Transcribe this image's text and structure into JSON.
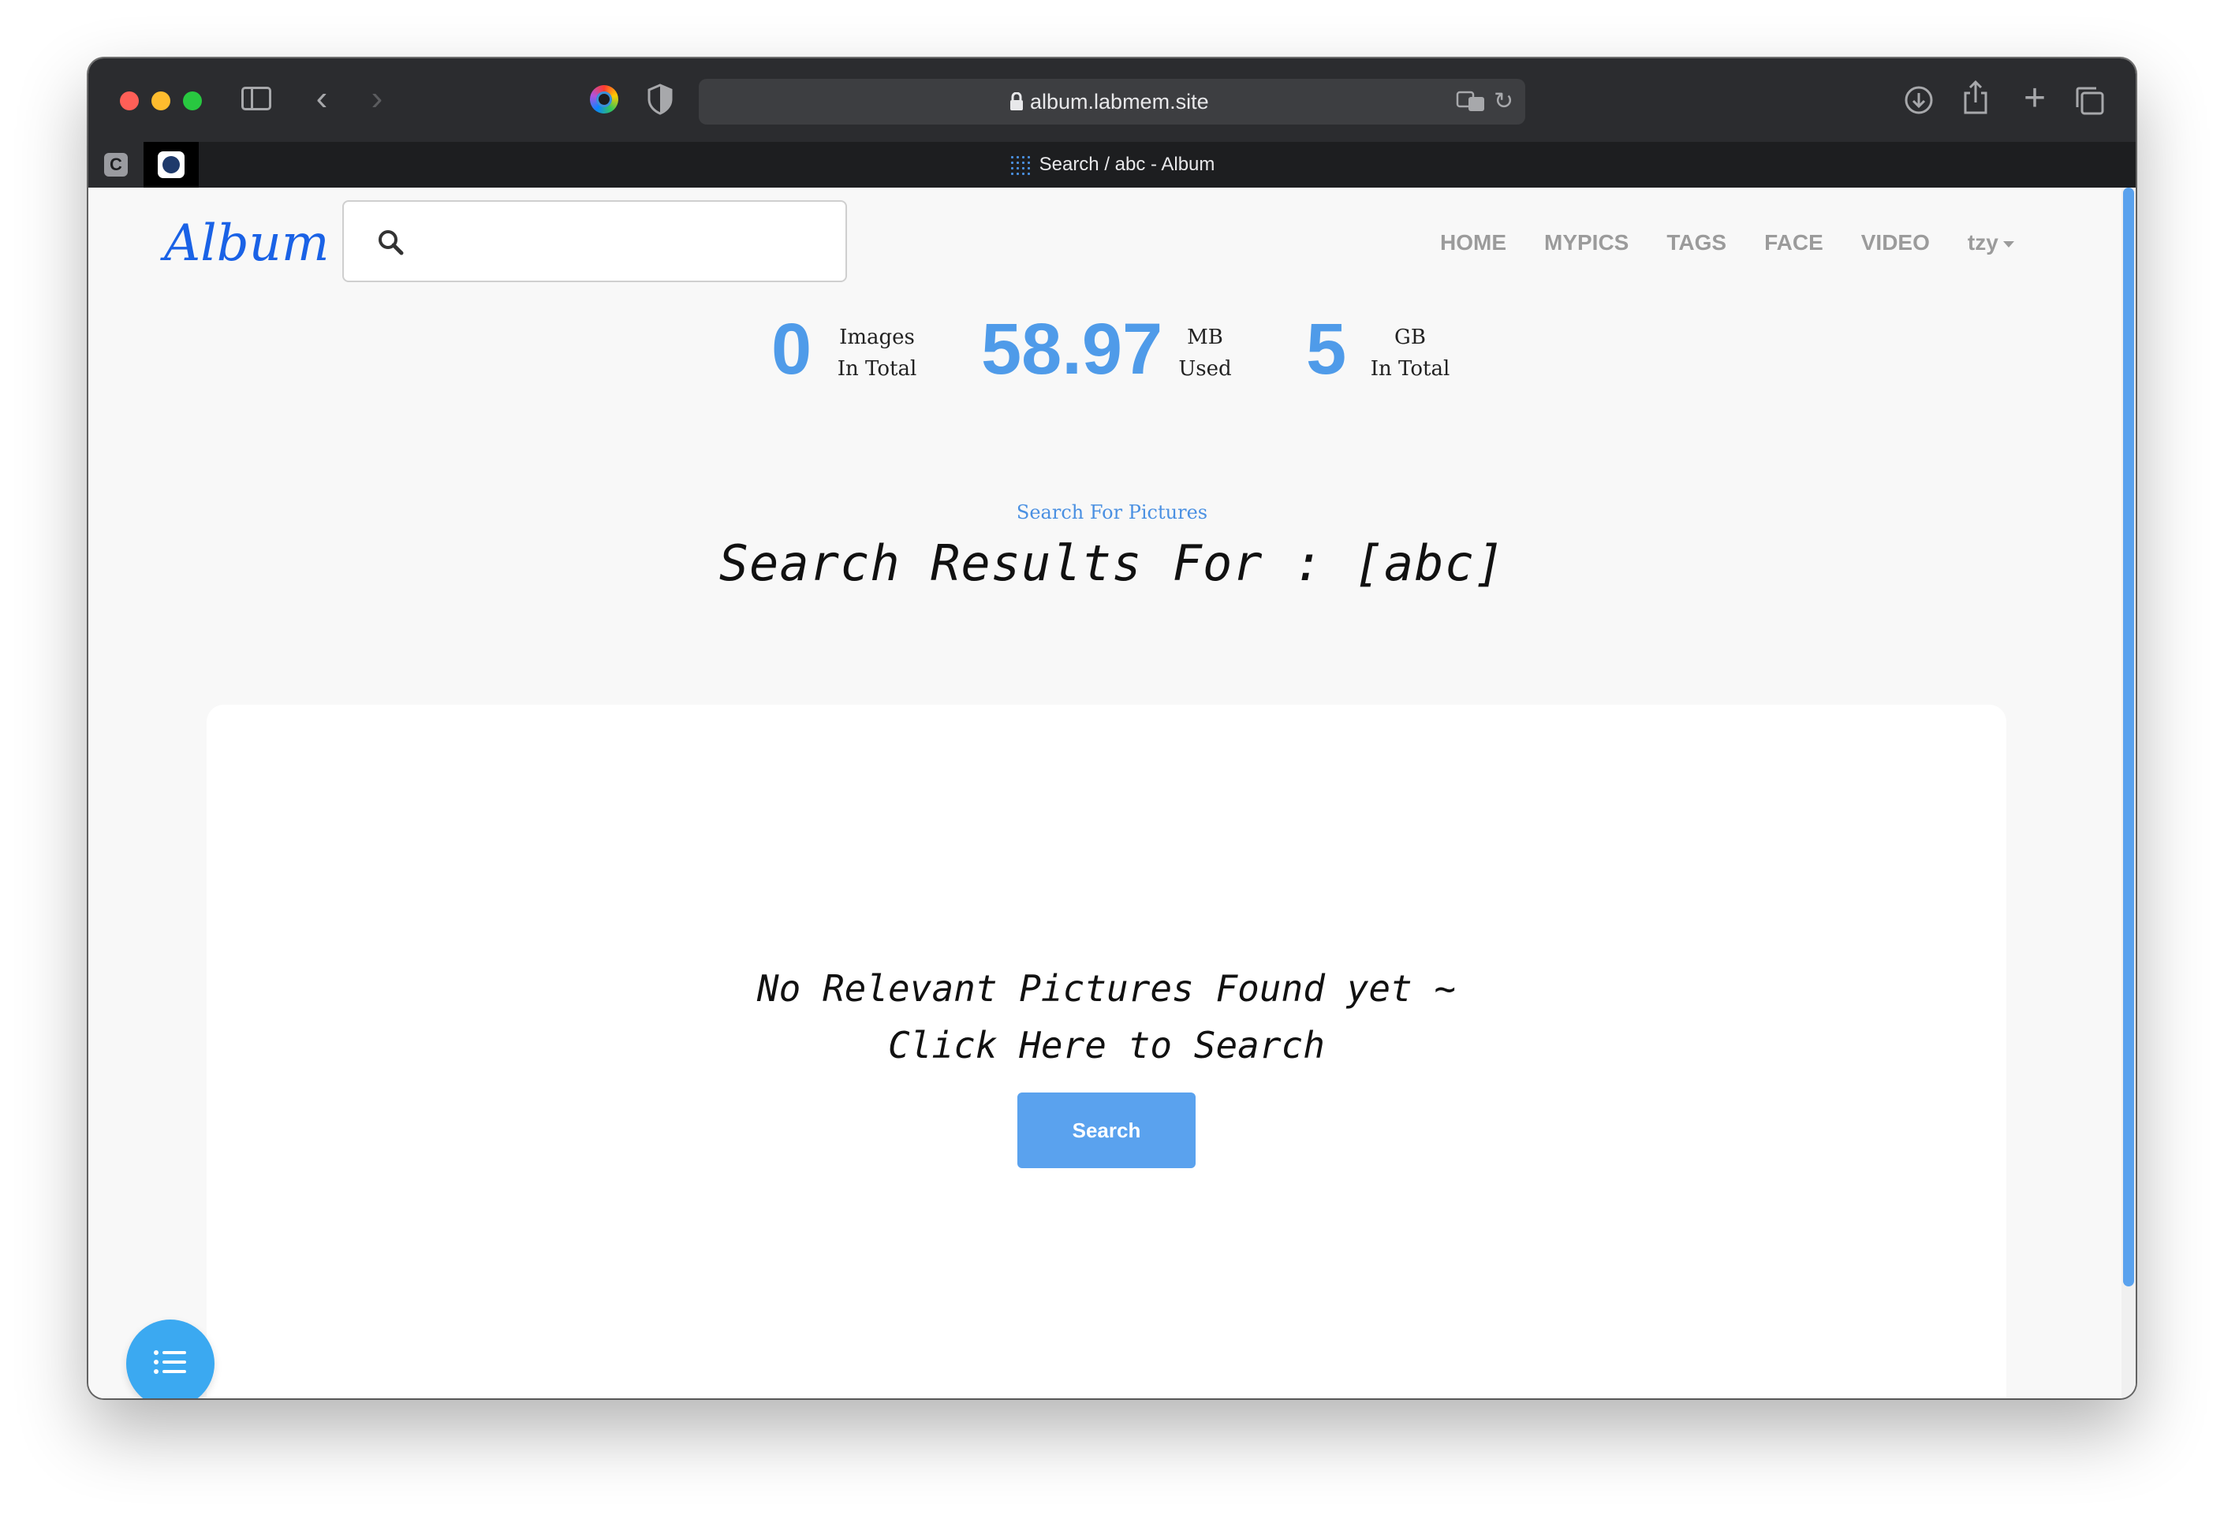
{
  "browser": {
    "url": "album.labmem.site",
    "tab_title": "Search / abc - Album",
    "pinned_tab_1": "C"
  },
  "header": {
    "logo": "Album",
    "search_value": "",
    "nav": [
      "HOME",
      "MYPICS",
      "TAGS",
      "FACE",
      "VIDEO"
    ],
    "user": "tzy"
  },
  "stats": [
    {
      "value": "0",
      "label1": "Images",
      "label2": "In Total"
    },
    {
      "value": "58.97",
      "label1": "MB",
      "label2": "Used"
    },
    {
      "value": "5",
      "label1": "GB",
      "label2": "In Total"
    }
  ],
  "main": {
    "subtitle": "Search For Pictures",
    "title": "Search Results For : [abc]",
    "empty_line1": "No Relevant Pictures Found yet ~",
    "empty_line2": "Click Here to Search",
    "search_button": "Search"
  },
  "colors": {
    "accent": "#4f9be9",
    "button": "#5aa2ee",
    "fab": "#3ba9f1",
    "logo": "#1a62e6"
  }
}
